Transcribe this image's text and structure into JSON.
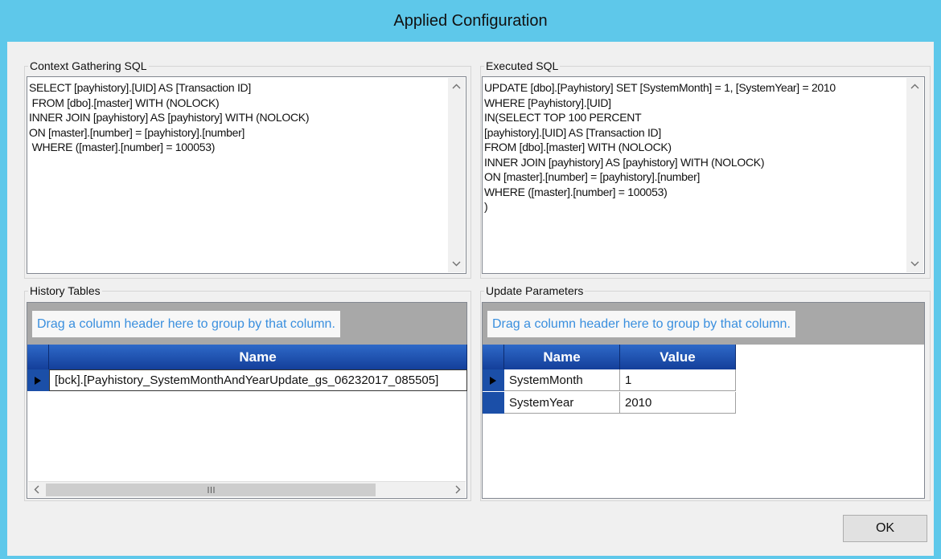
{
  "window": {
    "title": "Applied Configuration"
  },
  "context_sql": {
    "legend": "Context Gathering SQL",
    "text": "SELECT [payhistory].[UID] AS [Transaction ID]\n FROM [dbo].[master] WITH (NOLOCK)\nINNER JOIN [payhistory] AS [payhistory] WITH (NOLOCK)\nON [master].[number] = [payhistory].[number]\n WHERE ([master].[number] = 100053)"
  },
  "executed_sql": {
    "legend": "Executed SQL",
    "text": "UPDATE [dbo].[Payhistory] SET [SystemMonth] = 1, [SystemYear] = 2010\nWHERE [Payhistory].[UID]\nIN(SELECT TOP 100 PERCENT\n[payhistory].[UID] AS [Transaction ID]\nFROM [dbo].[master] WITH (NOLOCK)\nINNER JOIN [payhistory] AS [payhistory] WITH (NOLOCK)\nON [master].[number] = [payhistory].[number]\nWHERE ([master].[number] = 100053)\n)"
  },
  "history_tables": {
    "legend": "History Tables",
    "group_hint": "Drag a column header here to group by that column.",
    "columns": [
      "Name"
    ],
    "rows": [
      [
        "[bck].[Payhistory_SystemMonthAndYearUpdate_gs_06232017_085505]"
      ]
    ]
  },
  "update_parameters": {
    "legend": "Update Parameters",
    "group_hint": "Drag a column header here to group by that column.",
    "columns": [
      "Name",
      "Value"
    ],
    "rows": [
      [
        "SystemMonth",
        "1"
      ],
      [
        "SystemYear",
        "2010"
      ]
    ]
  },
  "buttons": {
    "ok": "OK"
  },
  "icons": {
    "scroll_up": "chevron-up-icon",
    "scroll_down": "chevron-down-icon",
    "scroll_left": "chevron-left-icon",
    "scroll_right": "chevron-right-icon",
    "row_indicator": "row-pointer-icon"
  },
  "colors": {
    "title_bar": "#5ec8ea",
    "grid_header": "#1b4fa8",
    "group_hint_text": "#3a8fde",
    "group_area": "#a8a8a8"
  }
}
